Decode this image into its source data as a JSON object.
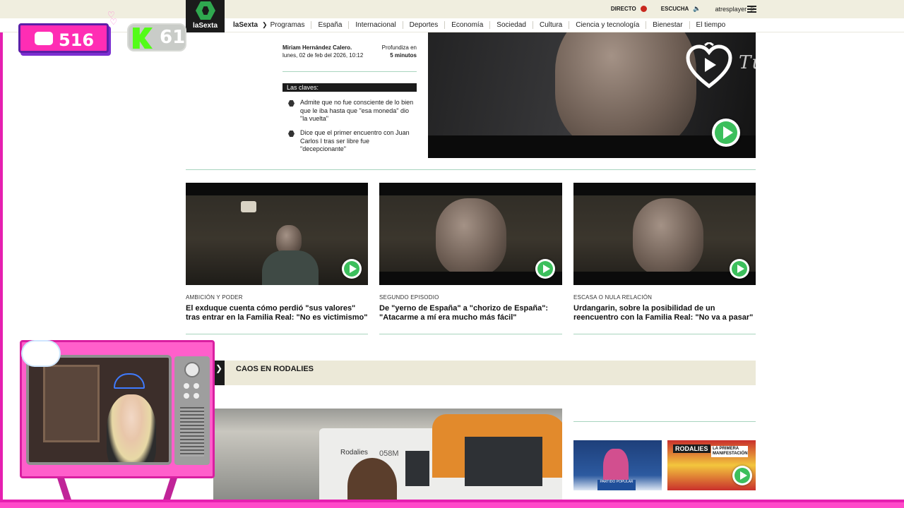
{
  "site": {
    "brand": "laSexta",
    "top_links": {
      "live": "DIRECTO",
      "listen": "ESCUCHA",
      "player": "atresplayer"
    }
  },
  "nav": {
    "section": "laSexta",
    "items": [
      "Programas",
      "España",
      "Internacional",
      "Deportes",
      "Economía",
      "Sociedad",
      "Cultura",
      "Ciencia y tecnología",
      "Bienestar",
      "El tiempo"
    ]
  },
  "article": {
    "author": "Miriam Hernández Calero.",
    "date": "lunes, 02 de feb del 2026, 10:12",
    "read_label": "Profundiza en",
    "read_time": "5 minutos",
    "claves_title": "Las claves:",
    "claves": [
      "Admite que no fue consciente de lo bien que le iba hasta que \"esa moneda\" dio \"la vuelta\"",
      "Dice que el primer encuentro con Juan Carlos I tras ser libre fue \"decepcionante\""
    ]
  },
  "related": [
    {
      "kicker": "AMBICIÓN Y PODER",
      "headline": "El exduque cuenta cómo perdió \"sus valores\" tras entrar en la Familia Real: \"No es victimismo\""
    },
    {
      "kicker": "SEGUNDO EPISODIO",
      "headline": "De \"yerno de España\" a \"chorizo de España\": \"Atacarme a mí era mucho más fácil\""
    },
    {
      "kicker": "ESCASA O NULA RELACIÓN",
      "headline": "Urdangarin, sobre la posibilidad de un reencuentro con la Familia Real: \"No va a pasar\""
    }
  ],
  "section": {
    "title": "CAOS EN RODALIES"
  },
  "train_image": {
    "brand": "Rodalies",
    "number": "058M"
  },
  "thumbs": {
    "podium": "PARTIDO POPULAR",
    "rodalies_label": "RODALIES",
    "rodalies_sub": "LA PRIMERA MANIFESTACIÓN"
  },
  "overlay": {
    "chat_count": "516",
    "kick_count": "61",
    "watermark": "Tutosdelotti"
  },
  "colors": {
    "accent_green": "#3cbf5c",
    "overlay_pink": "#ff2db4",
    "kick_green": "#53fc18"
  }
}
